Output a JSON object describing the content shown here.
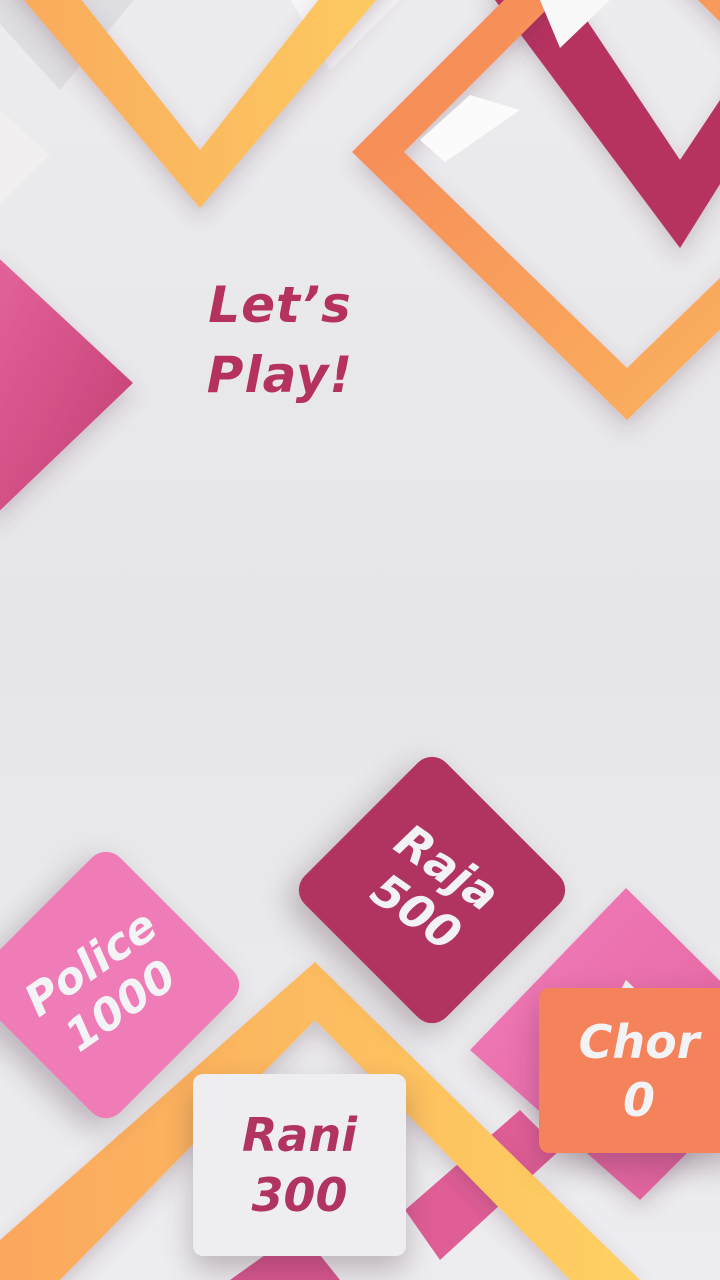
{
  "title": {
    "line1": "Let’s",
    "line2": "Play!"
  },
  "cards": {
    "raja": {
      "name": "Raja",
      "points": "500"
    },
    "police": {
      "name": "Police",
      "points": "1000"
    },
    "rani": {
      "name": "Rani",
      "points": "300"
    },
    "chor": {
      "name": "Chor",
      "points": "0"
    }
  },
  "colors": {
    "magenta": "#b13460",
    "pink": "#ef7bb7",
    "orange": "#f4825a",
    "yellow": "#fdc860",
    "background": "#e9e9eb"
  }
}
